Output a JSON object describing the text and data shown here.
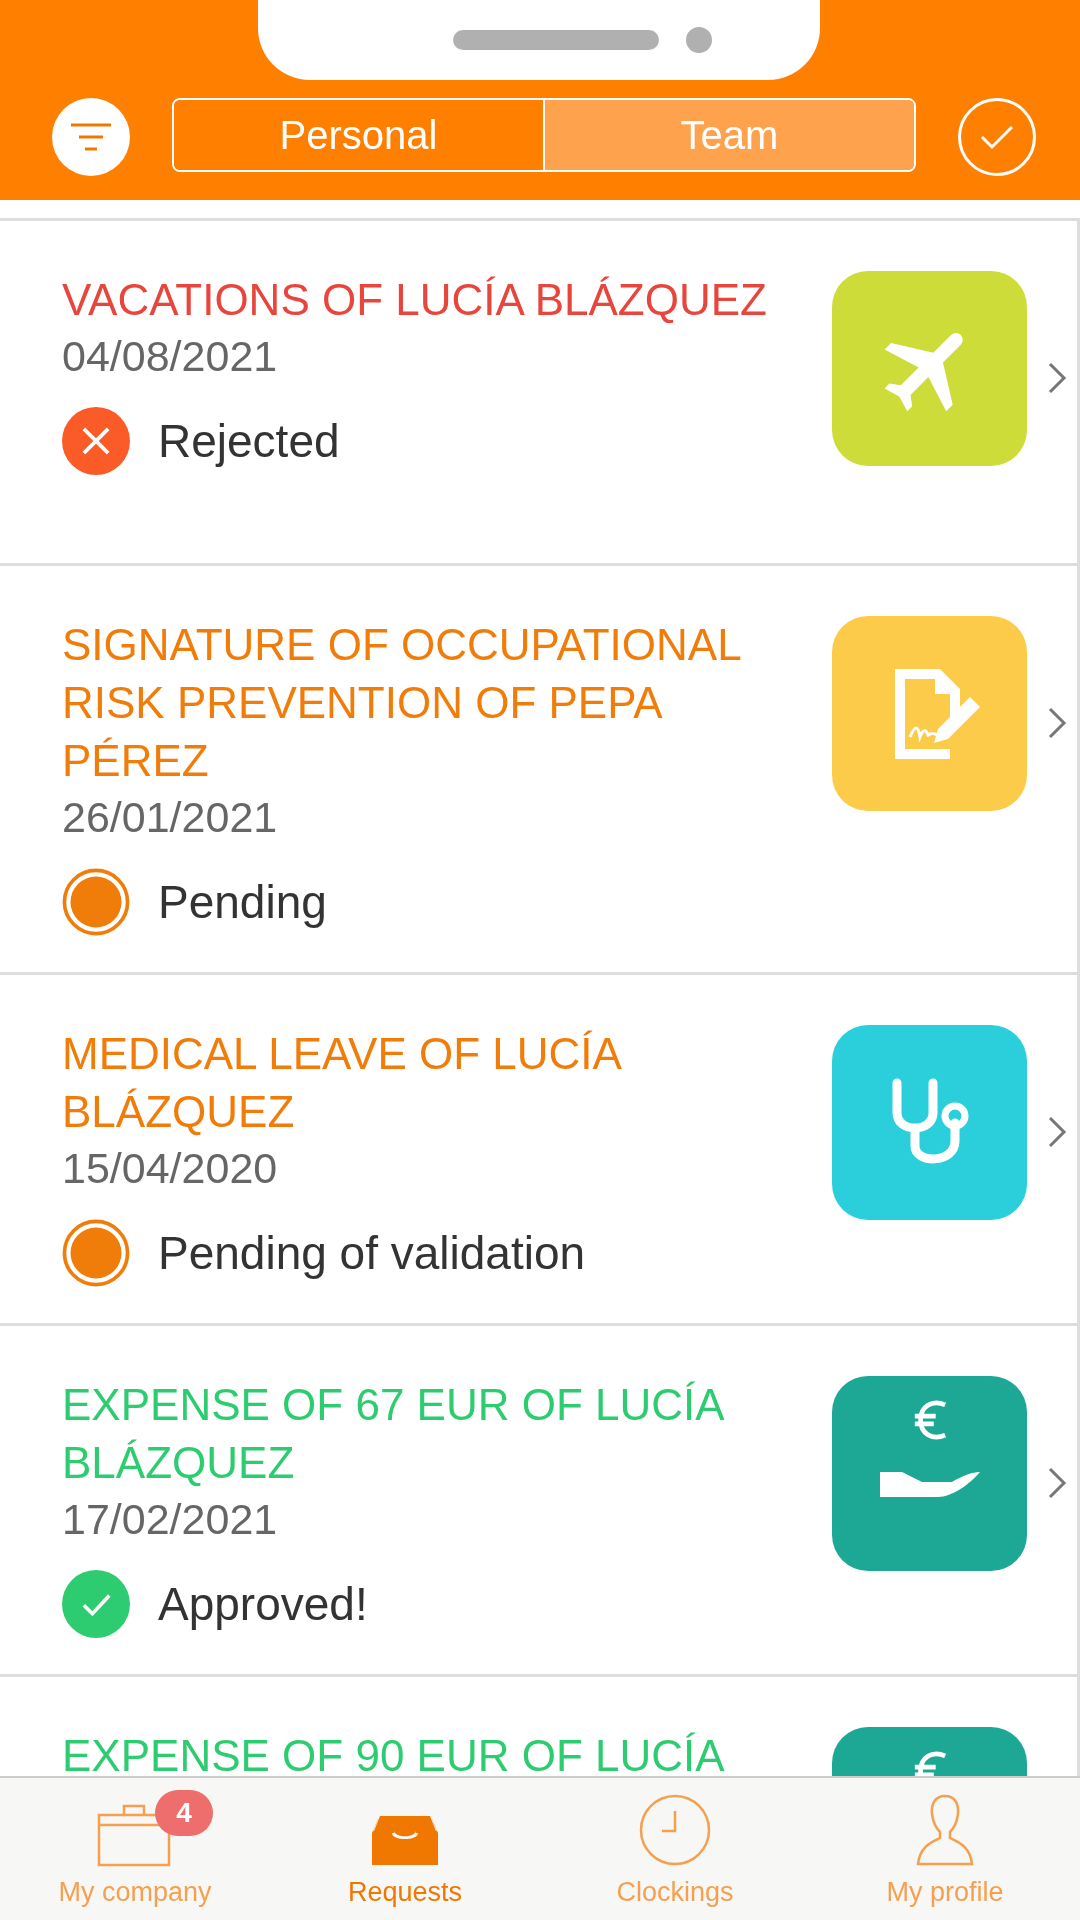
{
  "header": {
    "tabs": [
      {
        "label": "Personal",
        "selected": false
      },
      {
        "label": "Team",
        "selected": true
      }
    ]
  },
  "requests": [
    {
      "title": "VACATIONS OF LUCÍA BLÁZQUEZ",
      "date": "04/08/2021",
      "status": {
        "kind": "rejected",
        "label": "Rejected"
      },
      "kind": "plane",
      "color": "#cddc39"
    },
    {
      "title": "SIGNATURE OF OCCUPATIONAL RISK PREVENTION OF PEPA PÉREZ",
      "date": "26/01/2021",
      "status": {
        "kind": "pending",
        "label": "Pending"
      },
      "kind": "signature",
      "color": "#fccb4a"
    },
    {
      "title": "MEDICAL LEAVE OF LUCÍA BLÁZQUEZ",
      "date": "15/04/2020",
      "status": {
        "kind": "pending",
        "label": "Pending of validation"
      },
      "kind": "stethoscope",
      "color": "#2bcfdc"
    },
    {
      "title": "EXPENSE OF 67 EUR OF LUCÍA BLÁZQUEZ",
      "date": "17/02/2021",
      "status": {
        "kind": "approved",
        "label": "Approved!"
      },
      "kind": "euro",
      "color": "#1da896"
    },
    {
      "title": "EXPENSE OF 90 EUR OF LUCÍA",
      "kind": "euro",
      "color": "#1da896"
    }
  ],
  "nav": [
    {
      "label": "My company",
      "kind": "briefcase",
      "badge": "4",
      "selected": false
    },
    {
      "label": "Requests",
      "kind": "inbox",
      "selected": true
    },
    {
      "label": "Clockings",
      "kind": "clock",
      "selected": false
    },
    {
      "label": "My profile",
      "kind": "person",
      "selected": false
    }
  ]
}
